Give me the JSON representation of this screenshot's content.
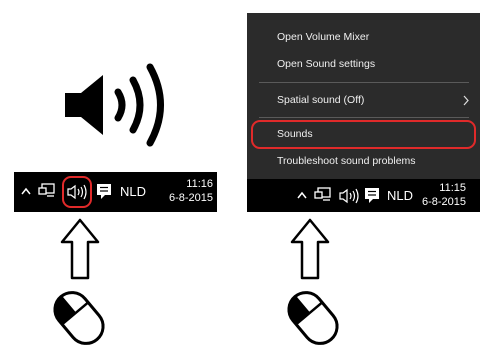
{
  "left_taskbar": {
    "language": "NLD",
    "time": "11:16",
    "date": "6-8-2015"
  },
  "right_taskbar": {
    "language": "NLD",
    "time": "11:15",
    "date": "6-8-2015"
  },
  "context_menu": {
    "items": [
      {
        "label": "Open Volume Mixer"
      },
      {
        "label": "Open Sound settings"
      },
      {
        "label": "Spatial sound (Off)"
      },
      {
        "label": "Sounds"
      },
      {
        "label": "Troubleshoot sound problems"
      }
    ]
  },
  "icons": [
    "speaker-icon",
    "chevron-up-icon",
    "network-icon",
    "volume-icon",
    "action-center-icon",
    "arrow-up-icon",
    "mouse-icon",
    "chevron-right-icon"
  ],
  "colors": {
    "highlight": "#e02a2a",
    "taskbar": "#000000",
    "menu": "#2b2b2b"
  }
}
